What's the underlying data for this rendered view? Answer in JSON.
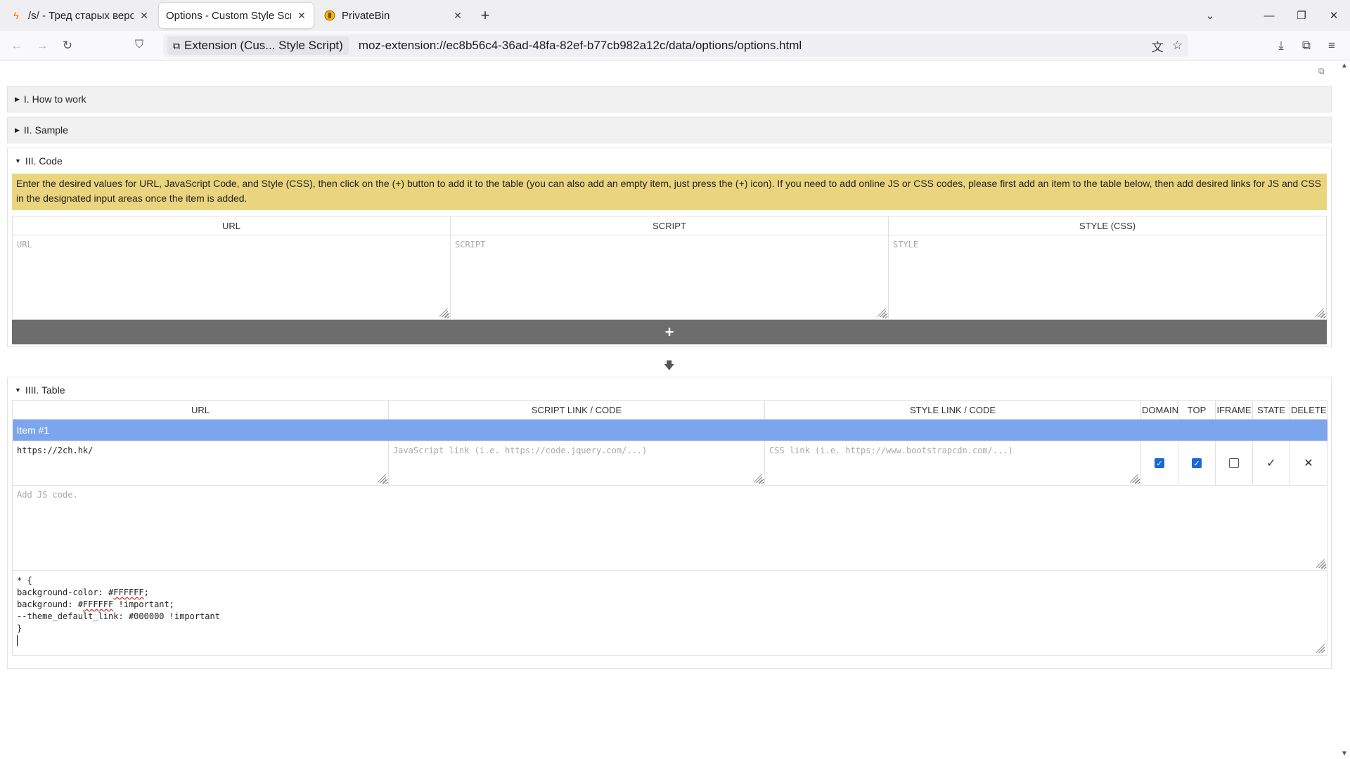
{
  "browser": {
    "tabs": [
      {
        "title": "/s/ - Тред старых верси",
        "icon": "lightning-icon",
        "active": false
      },
      {
        "title": "Options - Custom Style Scrip",
        "icon": "",
        "active": true
      },
      {
        "title": "PrivateBin",
        "icon": "privatebin-icon",
        "active": false
      }
    ],
    "identity_label": "Extension (Cus... Style Script)",
    "url": "moz-extension://ec8b56c4-36ad-48fa-82ef-b77cb982a12c/data/options/options.html"
  },
  "sections": {
    "how_to_work": "I. How to work",
    "sample": "II. Sample",
    "code": {
      "title": "III. Code",
      "notice": "Enter the desired values for URL, JavaScript Code, and Style (CSS), then click on the (+) button to add it to the table (you can also add an empty item, just press the (+) icon). If you need to add online JS or CSS codes, please first add an item to the table below, then add desired links for JS and CSS in the designated input areas once the item is added.",
      "columns": [
        "URL",
        "SCRIPT",
        "STYLE (CSS)"
      ],
      "placeholders": {
        "url": "URL",
        "script": "SCRIPT",
        "style": "STYLE"
      },
      "add_label": "+"
    },
    "table": {
      "title": "IIII. Table",
      "columns": [
        "URL",
        "SCRIPT LINK / CODE",
        "STYLE LINK / CODE",
        "DOMAIN",
        "TOP",
        "IFRAME",
        "STATE",
        "DELETE"
      ],
      "item": {
        "label": "Item #1",
        "url": "https://2ch.hk/",
        "script_placeholder": "JavaScript link (i.e. https://code.jquery.com/...)",
        "style_placeholder": "CSS link (i.e. https://www.bootstrapcdn.com/...)",
        "domain": true,
        "top": true,
        "iframe": false,
        "state_mark": "✓",
        "delete_mark": "✕",
        "js_placeholder": "Add JS code.",
        "css_lines": [
          "* {",
          "background-color: #FFFFFF;",
          "background: #FFFFFF !important;",
          "--theme_default_link: #000000 !important",
          "}"
        ]
      }
    }
  },
  "colors": {
    "notice_bg": "#ead57e",
    "item_header_bg": "#7da5ee",
    "add_button_bg": "#6d6d6d",
    "checkbox_on": "#1a68d4"
  }
}
